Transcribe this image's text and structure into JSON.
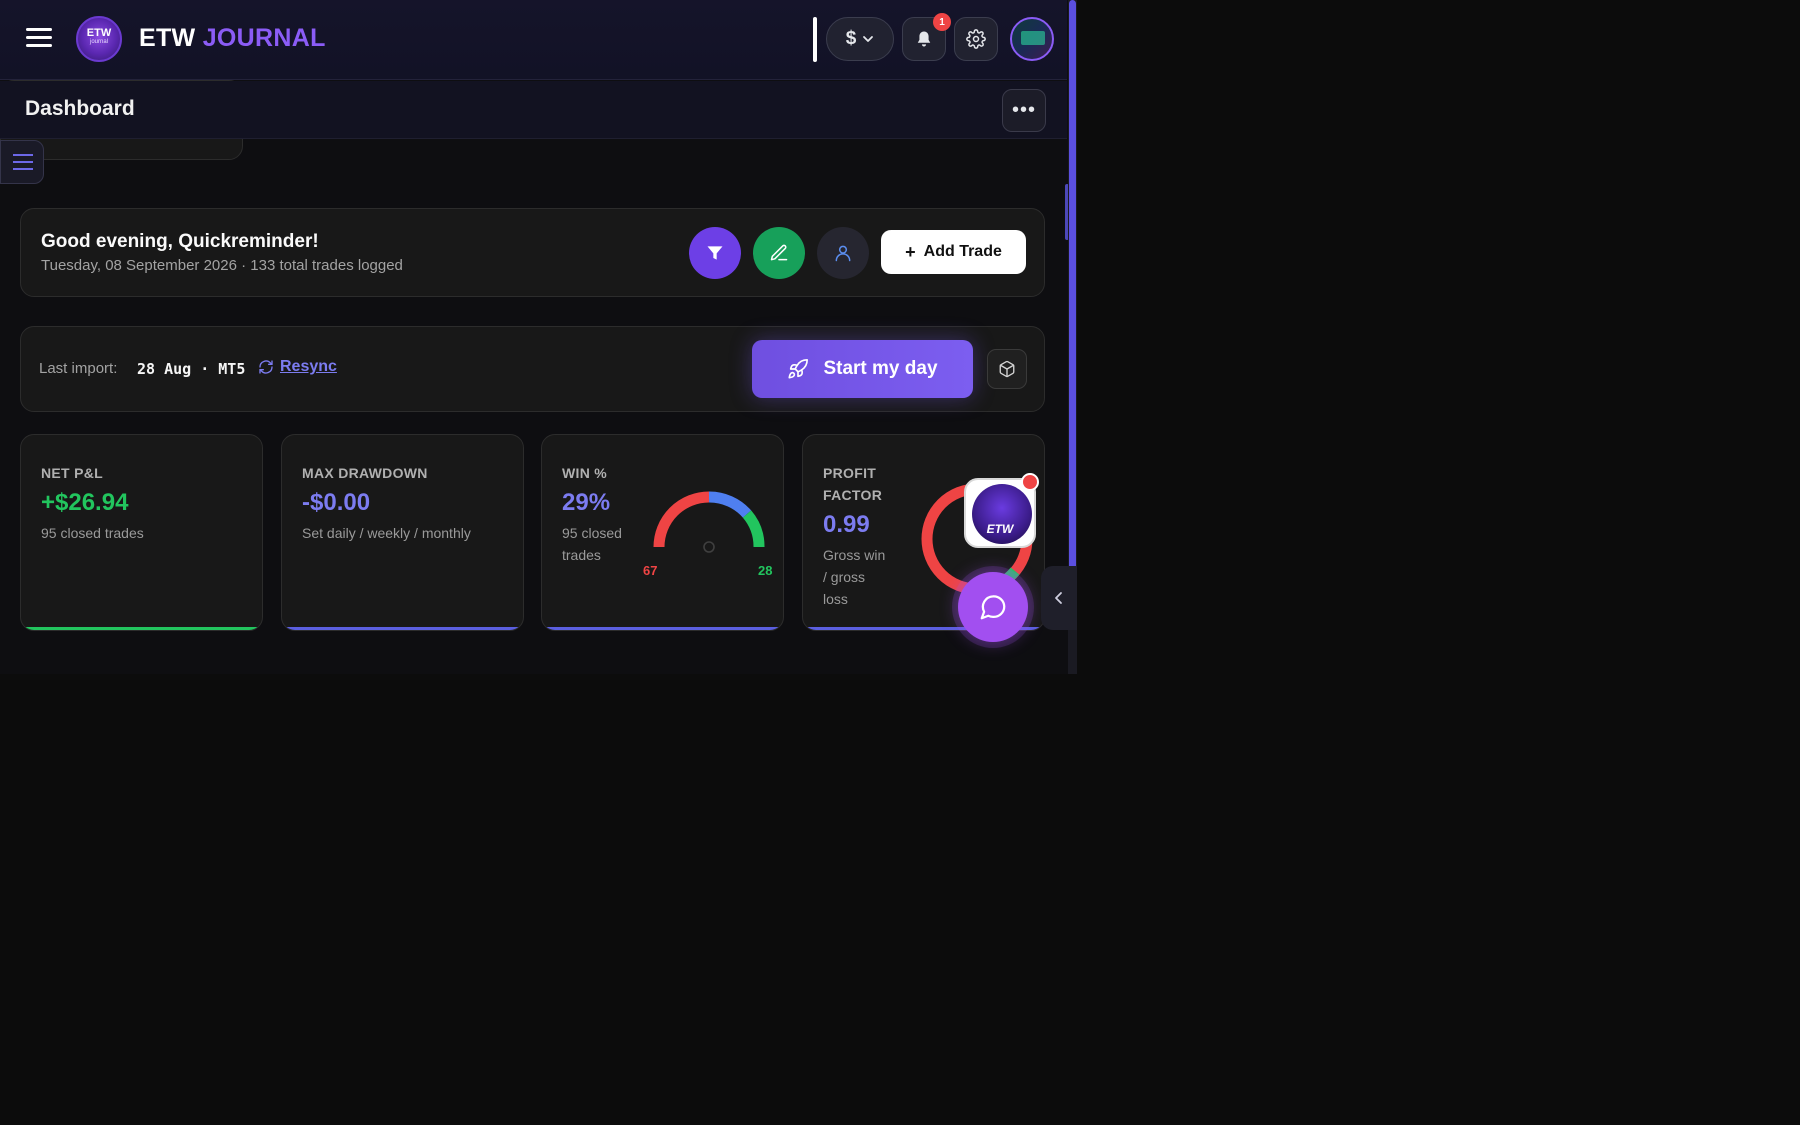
{
  "header": {
    "logo_line1": "ETW",
    "logo_line2": "journal",
    "brand_part1": "ETW",
    "brand_part2": "JOURNAL",
    "currency_symbol": "$",
    "notification_count": "1",
    "icons": [
      "menu-icon",
      "bell-icon",
      "gear-icon",
      "chevron-down-icon"
    ]
  },
  "dashboard_bar": {
    "title": "Dashboard",
    "more_label": "•••"
  },
  "greeting": {
    "title": "Good evening, Quickreminder!",
    "subtitle": "Tuesday, 08 September 2026 · 133 total trades logged",
    "add_trade_label": "Add Trade",
    "add_trade_icon": "+"
  },
  "import_bar": {
    "label": "Last import:",
    "value": "28 Aug · MT5",
    "resync_label": "Resync",
    "start_day_label": "Start my day"
  },
  "stats": [
    {
      "label": "NET P&L",
      "value": "+$26.94",
      "sub": "95 closed trades",
      "value_color": "#22c55e",
      "bar_color": "#22c55e"
    },
    {
      "label": "MAX DRAWDOWN",
      "value": "-$0.00",
      "sub": "Set daily / weekly / monthly",
      "value_color": "#7c7cf0",
      "bar_color": "#5b5fe0"
    },
    {
      "label": "WIN %",
      "value": "29%",
      "sub_line1": "95 closed",
      "sub_line2": "trades",
      "value_color": "#7c7cf0",
      "bar_color": "#5b5fe0",
      "gauge": {
        "losses": "67",
        "wins": "28",
        "loss_color": "#ef4444",
        "win_color": "#22c55e",
        "neutral_color": "#4f7ff0"
      }
    },
    {
      "label_line1": "PROFIT",
      "label_line2": "FACTOR",
      "value": "0.99",
      "sub_line1": "Gross win",
      "sub_line2": "/ gross",
      "sub_line3": "loss",
      "value_color": "#7c7cf0",
      "bar_color": "#5b5fe0"
    }
  ],
  "floating": {
    "promo_text": "ETW"
  },
  "colors": {
    "accent": "#8b5cf6",
    "profit": "#22c55e",
    "loss": "#ef4444",
    "background": "#0e0e11"
  }
}
